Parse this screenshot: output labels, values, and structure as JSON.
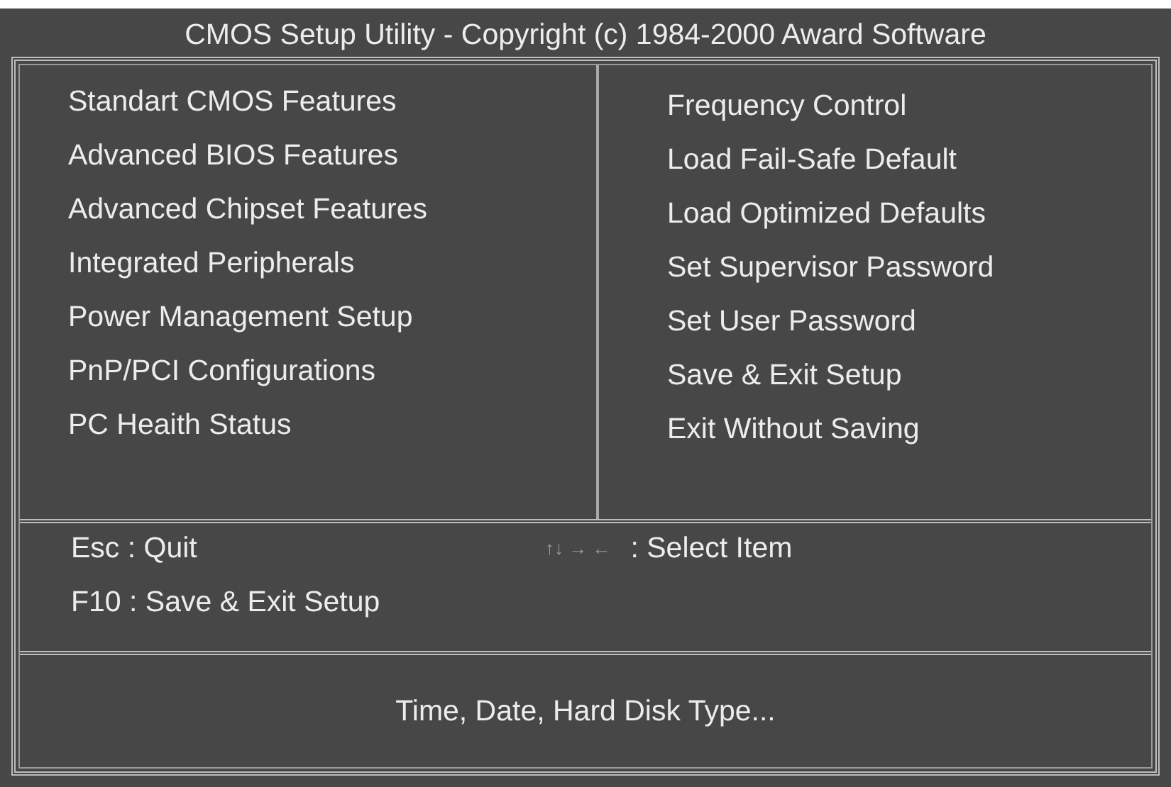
{
  "window": {
    "title": "CMOS Setup Utility - Copyright (c) 1984-2000 Award Software"
  },
  "menu": {
    "left": [
      "Standart CMOS Features",
      "Advanced BIOS Features",
      "Advanced Chipset Features",
      "Integrated Peripherals",
      "Power Management Setup",
      "PnP/PCI Configurations",
      "PC Heaith Status"
    ],
    "right": [
      "Frequency Control",
      "Load Fail-Safe Default",
      "Load Optimized Defaults",
      "Set Supervisor Password",
      "Set User Password",
      "Save & Exit Setup",
      "Exit Without Saving"
    ]
  },
  "keys": {
    "left": [
      "Esc : Quit",
      "F10 : Save & Exit Setup"
    ],
    "arrows": "↑↓ → ←",
    "select": ": Select Item"
  },
  "help": "Time, Date, Hard Disk Type..."
}
